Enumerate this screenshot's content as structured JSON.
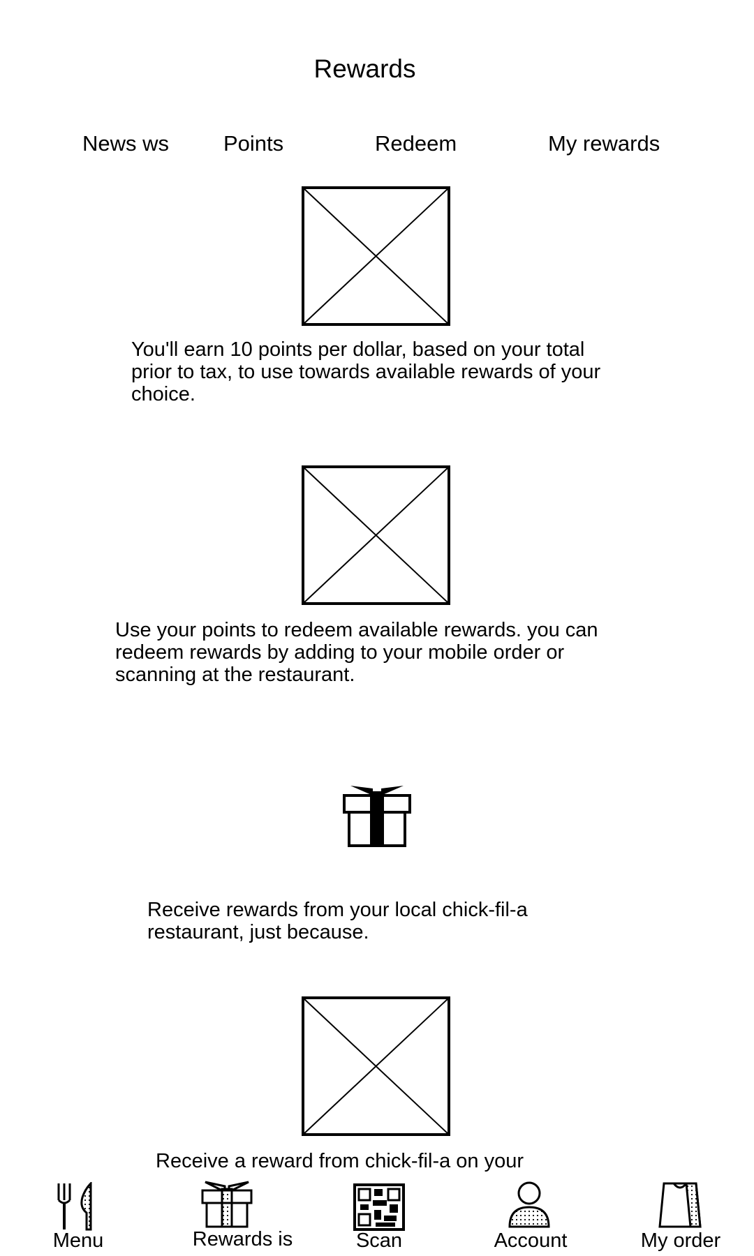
{
  "header": {
    "title": "Rewards"
  },
  "tabs": [
    {
      "label": "News ws"
    },
    {
      "label": "Points"
    },
    {
      "label": "Redeem"
    },
    {
      "label": "My rewards"
    }
  ],
  "content": {
    "sections": [
      {
        "text": "You'll earn 10 points per dollar, based on your total\nprior to tax, to use towards available rewards of your\nchoice."
      },
      {
        "text": "Use your points to redeem available rewards. you can\nredeem rewards by adding to your mobile order or\nscanning at the restaurant."
      },
      {
        "icon": "gift-icon",
        "text": "Receive rewards from your local chick-fil-a\nrestaurant, just because."
      },
      {
        "text": "Receive a reward from chick-fil-a on your"
      }
    ]
  },
  "bottom_nav": [
    {
      "label": "Menu",
      "icon": "fork-knife-icon"
    },
    {
      "label": "Rewards is",
      "icon": "gift-icon"
    },
    {
      "label": "Scan",
      "icon": "qr-code-icon"
    },
    {
      "label": "Account",
      "icon": "person-icon"
    },
    {
      "label": "My order",
      "icon": "bag-icon"
    }
  ]
}
